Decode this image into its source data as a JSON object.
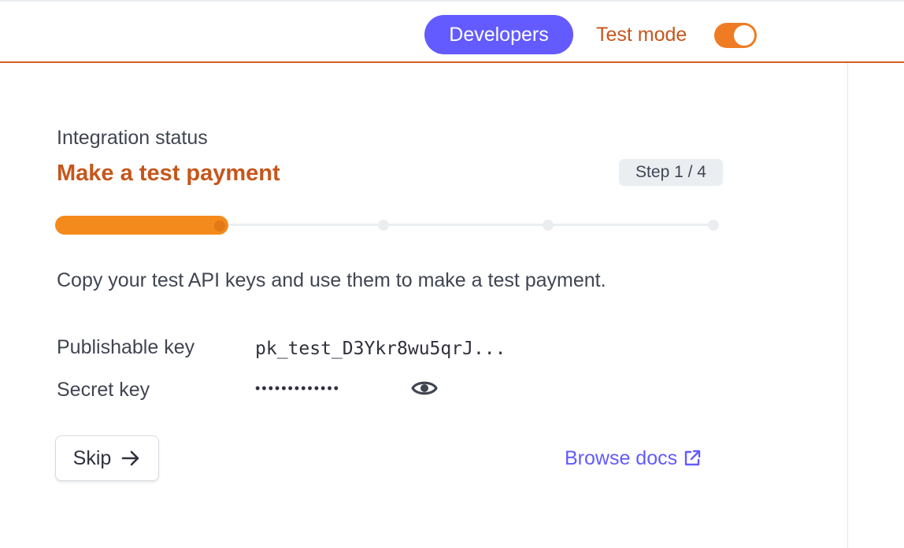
{
  "header": {
    "developers_label": "Developers",
    "test_mode_label": "Test mode",
    "test_mode_on": true
  },
  "integration": {
    "section_label": "Integration status",
    "title": "Make a test payment",
    "step_badge": "Step 1 / 4",
    "current_step": 1,
    "total_steps": 4,
    "instructions": "Copy your test API keys and use them to make a test payment."
  },
  "keys": {
    "publishable_label": "Publishable key",
    "publishable_value": "pk_test_D3Ykr8wu5qrJ...",
    "secret_label": "Secret key",
    "secret_value": "•••••••••••••"
  },
  "actions": {
    "skip_label": "Skip",
    "browse_docs_label": "Browse docs"
  },
  "colors": {
    "brand": "#635bff",
    "accent_orange": "#c6561c",
    "progress_orange": "#f48a1c"
  },
  "icons": {
    "reveal": "eye-icon",
    "skip": "arrow-right-icon",
    "docs": "external-link-icon"
  }
}
